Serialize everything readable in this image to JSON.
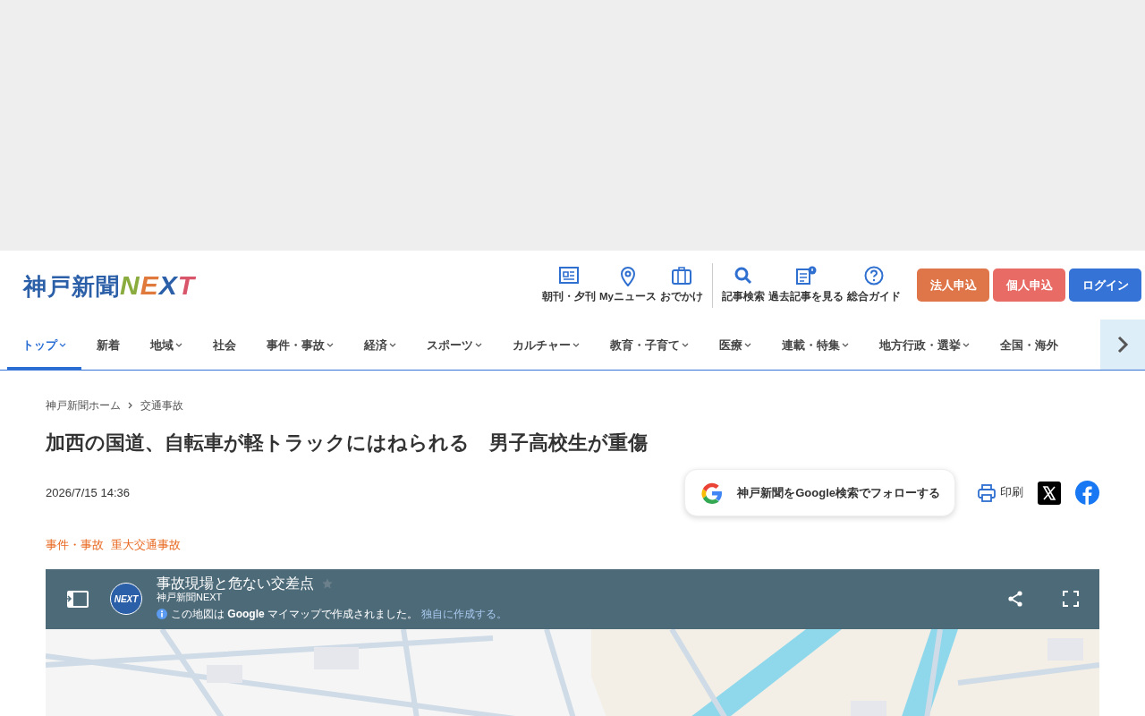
{
  "logo": {
    "text": "神戸新聞",
    "letters": [
      {
        "char": "N",
        "color": "#8aac3e"
      },
      {
        "char": "E",
        "color": "#e07a3c"
      },
      {
        "char": "X",
        "color": "#2b5fa8"
      },
      {
        "char": "T",
        "color": "#d9556a"
      }
    ]
  },
  "header_links": [
    {
      "kind": "newspaper",
      "label": "朝刊・夕刊"
    },
    {
      "kind": "pin",
      "label": "Myニュース"
    },
    {
      "kind": "suitcase",
      "label": "おでかけ"
    },
    {
      "kind": "search",
      "label": "記事検索"
    },
    {
      "kind": "archive",
      "label": "過去記事を見る"
    },
    {
      "kind": "help",
      "label": "総合ガイド"
    }
  ],
  "header_buttons": [
    {
      "label": "法人申込",
      "color": "#de764a"
    },
    {
      "label": "個人申込",
      "color": "#e86b66"
    },
    {
      "label": "ログイン",
      "color": "#3573d6"
    }
  ],
  "nav": [
    {
      "label": "トップ",
      "has_menu": true,
      "selected": true
    },
    {
      "label": "新着",
      "has_menu": false,
      "selected": false
    },
    {
      "label": "地域",
      "has_menu": true,
      "selected": false
    },
    {
      "label": "社会",
      "has_menu": false,
      "selected": false
    },
    {
      "label": "事件・事故",
      "has_menu": true,
      "selected": false
    },
    {
      "label": "経済",
      "has_menu": true,
      "selected": false
    },
    {
      "label": "スポーツ",
      "has_menu": true,
      "selected": false
    },
    {
      "label": "カルチャー",
      "has_menu": true,
      "selected": false
    },
    {
      "label": "教育・子育て",
      "has_menu": true,
      "selected": false
    },
    {
      "label": "医療",
      "has_menu": true,
      "selected": false
    },
    {
      "label": "連載・特集",
      "has_menu": true,
      "selected": false
    },
    {
      "label": "地方行政・選挙",
      "has_menu": true,
      "selected": false
    },
    {
      "label": "全国・海外",
      "has_menu": false,
      "selected": false
    }
  ],
  "breadcrumb": [
    "神戸新聞ホーム",
    "交通事故"
  ],
  "article": {
    "title": "加西の国道、自転車が軽トラックにはねられる　男子高校生が重傷",
    "date": "2026/7/15 14:36",
    "follow_button": "神戸新聞をGoogle検索でフォローする",
    "print": "印刷",
    "tags": [
      "事件・事故",
      "重大交通事故"
    ]
  },
  "map": {
    "badge": "NEXT",
    "title": "事故現場と危ない交差点",
    "owner": "神戸新聞NEXT",
    "notice": "この地図は **Google** マイマップで作成されました。",
    "notice_link": "独自に作成する。"
  }
}
